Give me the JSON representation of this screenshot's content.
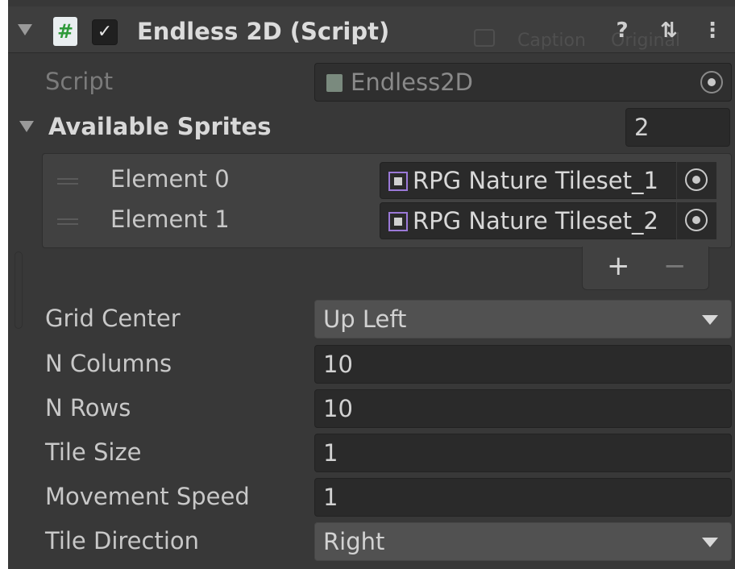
{
  "component": {
    "title": "Endless 2D (Script)",
    "enabled_checkmark": "✓",
    "script_icon_glyph": "#",
    "faded_caption": "Caption",
    "faded_original": "Original",
    "help_glyph": "?",
    "presets_glyph": "⇅",
    "menu_glyph": "⋮"
  },
  "script_field": {
    "label": "Script",
    "value": "Endless2D"
  },
  "available_sprites": {
    "label": "Available Sprites",
    "count": "2",
    "elements": [
      {
        "label": "Element 0",
        "value": "RPG Nature Tileset_1"
      },
      {
        "label": "Element 1",
        "value": "RPG Nature Tileset_2"
      }
    ],
    "add_glyph": "+",
    "remove_glyph": "−"
  },
  "fields": {
    "grid_center": {
      "label": "Grid Center",
      "value": "Up Left"
    },
    "n_columns": {
      "label": "N Columns",
      "value": "10"
    },
    "n_rows": {
      "label": "N Rows",
      "value": "10"
    },
    "tile_size": {
      "label": "Tile Size",
      "value": "1"
    },
    "movement_speed": {
      "label": "Movement Speed",
      "value": "1"
    },
    "tile_direction": {
      "label": "Tile Direction",
      "value": "Right"
    }
  },
  "colors": {
    "panel_bg": "#383838",
    "field_bg": "#2a2a2a",
    "dropdown_bg": "#515151",
    "script_icon_green": "#2f9a3a",
    "sprite_icon_purple": "#9b79d8"
  }
}
